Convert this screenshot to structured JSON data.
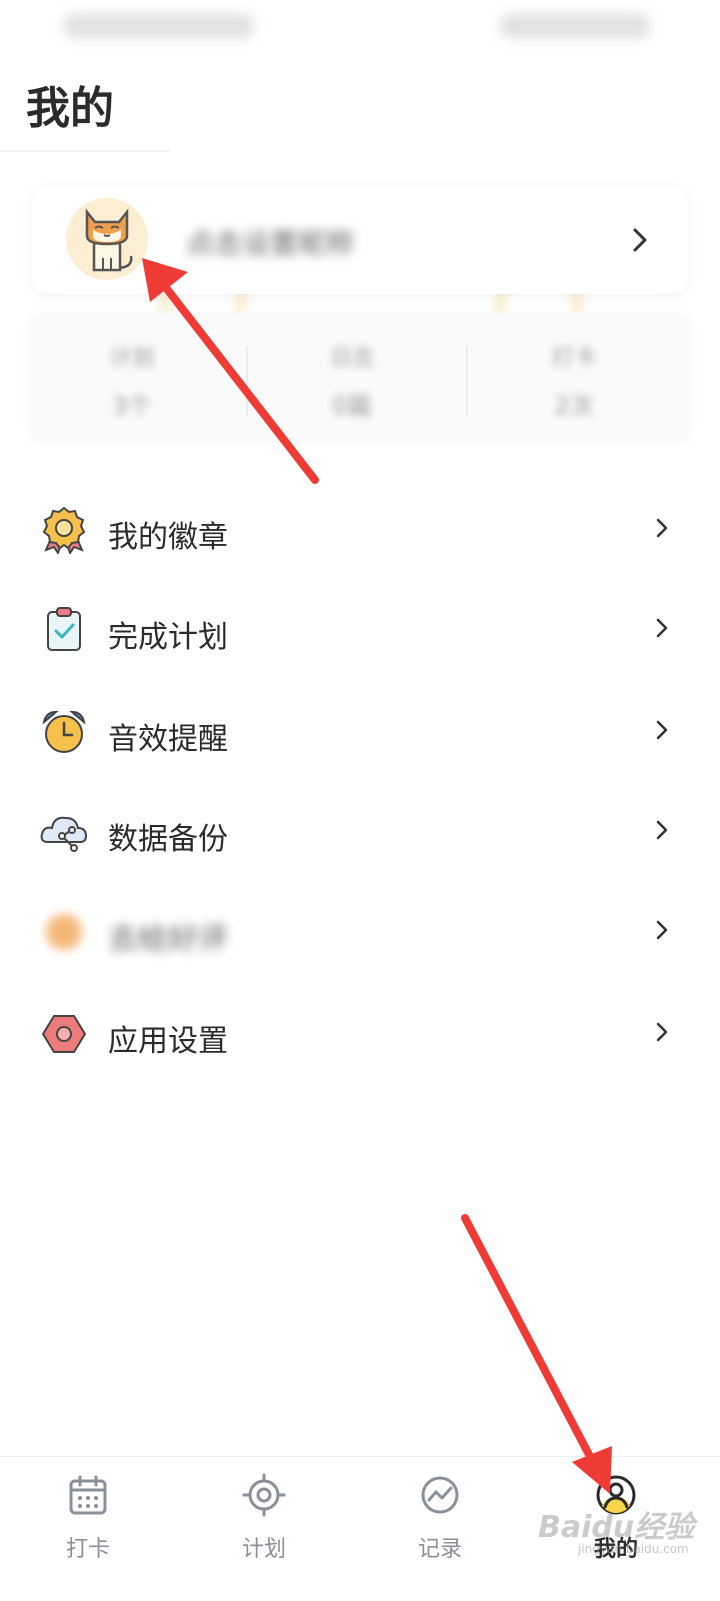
{
  "header": {
    "title": "我的"
  },
  "profile": {
    "nickname": "点击设置昵称"
  },
  "stats": [
    {
      "label": "计划",
      "value": "3个"
    },
    {
      "label": "日志",
      "value": "0篇"
    },
    {
      "label": "打卡",
      "value": "2次"
    }
  ],
  "menu": [
    {
      "label": "我的徽章",
      "icon": "badge-medal-icon"
    },
    {
      "label": "完成计划",
      "icon": "clipboard-check-icon"
    },
    {
      "label": "音效提醒",
      "icon": "alarm-clock-icon"
    },
    {
      "label": "数据备份",
      "icon": "cloud-share-icon"
    },
    {
      "label": "去给好评",
      "icon": "star-rate-icon"
    },
    {
      "label": "应用设置",
      "icon": "settings-hexagon-icon"
    }
  ],
  "bottom_nav": [
    {
      "label": "打卡",
      "icon": "calendar-icon",
      "active": false
    },
    {
      "label": "计划",
      "icon": "target-icon",
      "active": false
    },
    {
      "label": "记录",
      "icon": "chart-icon",
      "active": false
    },
    {
      "label": "我的",
      "icon": "user-icon",
      "active": true
    }
  ],
  "watermark": {
    "brand": "Baidu经验",
    "url": "jingyan.baidu.com"
  },
  "colors": {
    "accent_red": "#ee3b36",
    "avatar_bg": "#fbeed3",
    "active_nav": "#f7d64a"
  }
}
